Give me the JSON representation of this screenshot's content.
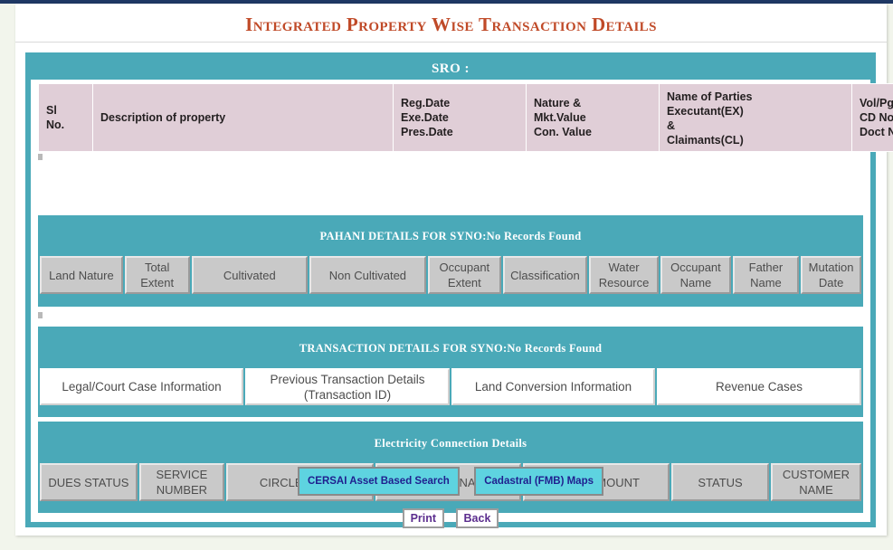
{
  "page": {
    "title": "Integrated Property Wise Transaction Details"
  },
  "sro": {
    "banner_label": "SRO :"
  },
  "property_table": {
    "columns": [
      "Sl No.",
      "Description of property",
      "Reg.Date Exe.Date Pres.Date",
      "Nature & Mkt.Value Con. Value",
      "Name of Parties Executant(EX) & Claimants(CL)",
      "Vol/Pg No CD No Doct No/Year"
    ],
    "sl_no_line1": "Sl",
    "sl_no_line2": "No.",
    "description": "Description of property",
    "date_line1": "Reg.Date",
    "date_line2": "Exe.Date",
    "date_line3": "Pres.Date",
    "nature_line1": "Nature &",
    "nature_line2": "Mkt.Value",
    "nature_line3": "Con. Value",
    "parties_line1": "Name of Parties",
    "parties_line2": "Executant(EX)",
    "parties_line3": "&",
    "parties_line4": "Claimants(CL)",
    "vol_line1": "Vol/Pg No",
    "vol_line2": "CD No",
    "vol_line3": "Doct No/Year",
    "rows": []
  },
  "pahani": {
    "title": "PAHANI DETAILS FOR SYNO:No Records Found",
    "columns": [
      "Land Nature",
      "Total Extent",
      "Cultivated",
      "Non Cultivated",
      "Occupant Extent",
      "Classification",
      "Water Resource",
      "Occupant Name",
      "Father Name",
      "Mutation Date"
    ],
    "rows": []
  },
  "transaction": {
    "title": "TRANSACTION DETAILS FOR SYNO:No Records Found",
    "tabs": [
      "Legal/Court Case Information",
      "Previous Transaction Details (Transaction ID)",
      "Land Conversion Information",
      "Revenue Cases"
    ]
  },
  "electricity": {
    "title": "Electricity Connection Details",
    "columns": [
      "DUES STATUS",
      "SERVICE NUMBER",
      "CIRCLE NAME",
      "SECTION NAME",
      "DUES AMOUNT",
      "STATUS",
      "CUSTOMER NAME"
    ],
    "rows": []
  },
  "actions": {
    "cersai_label": "CERSAI Asset Based Search",
    "cadastral_label": "Cadastral (FMB) Maps",
    "print_label": "Print",
    "back_label": "Back"
  },
  "colors": {
    "teal": "#4aa9b8",
    "title_rust": "#c04a28",
    "header_pink": "#e0ced7",
    "header_gray": "#c9c9c9",
    "button_cyan": "#5ed3e0",
    "button_text_navy": "#1f1f8f",
    "nav_text_purple": "#5b2d8e",
    "top_rule_navy": "#1f3864"
  }
}
